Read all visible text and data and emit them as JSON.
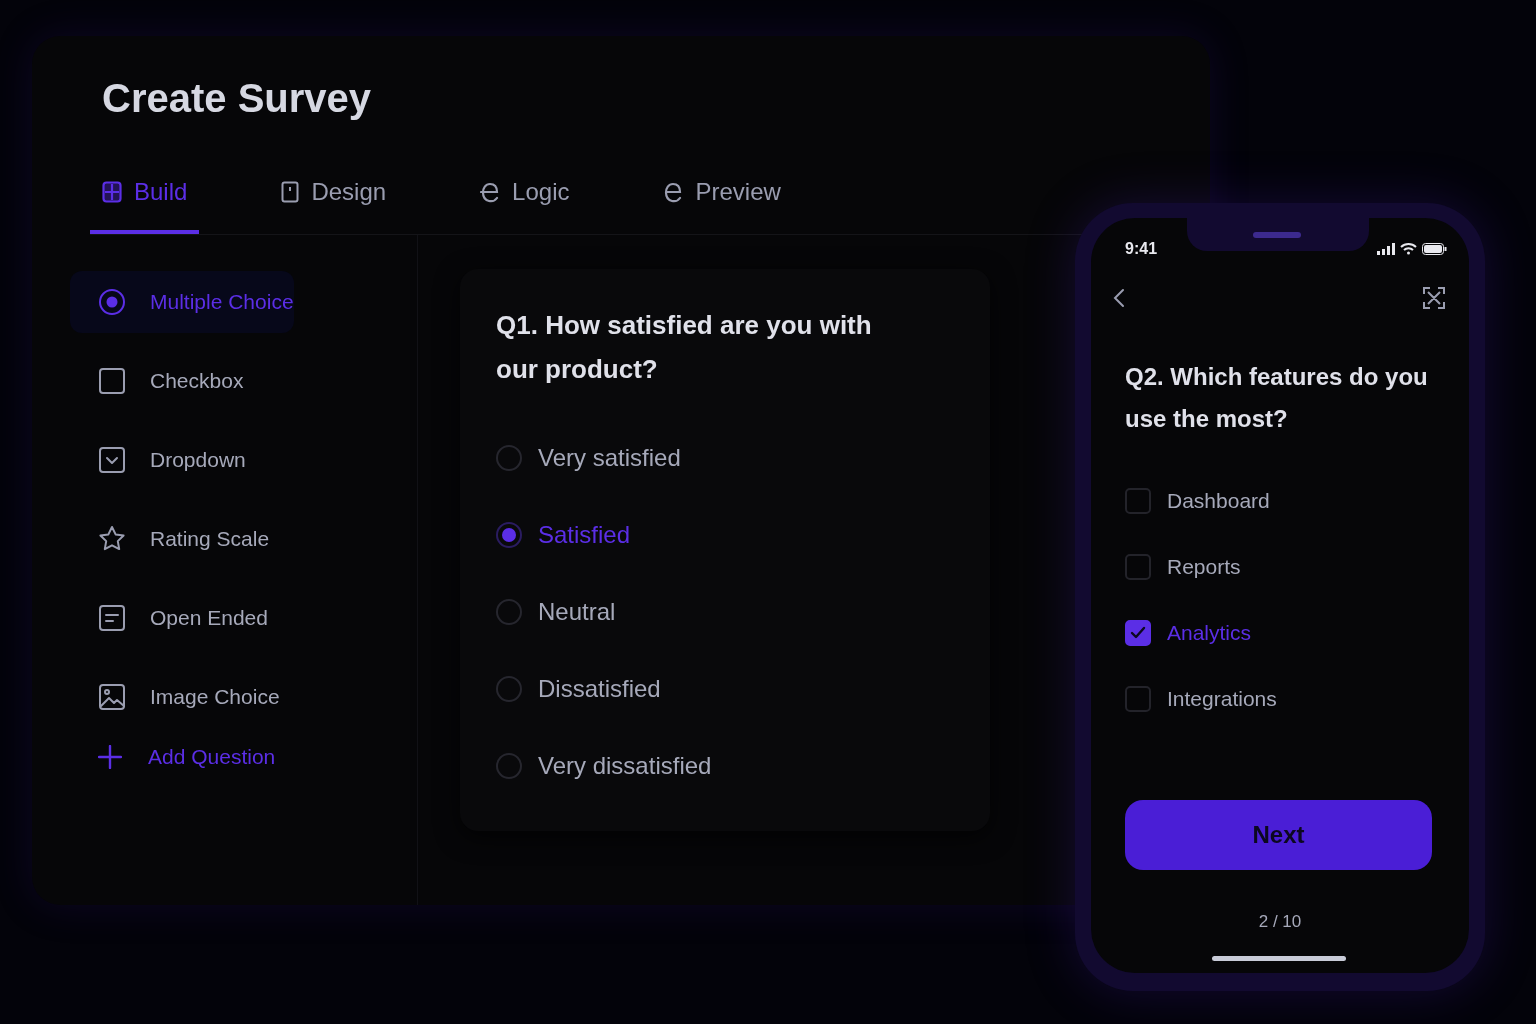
{
  "title": "Create Survey",
  "tabs": [
    {
      "label": "Build",
      "kind": "build",
      "selected": true
    },
    {
      "label": "Design",
      "kind": "design",
      "selected": false
    },
    {
      "label": "Logic",
      "kind": "logic",
      "selected": false
    },
    {
      "label": "Preview",
      "kind": "preview",
      "selected": false
    }
  ],
  "question_types": [
    {
      "label": "Multiple Choice",
      "kind": "radio",
      "selected": true
    },
    {
      "label": "Checkbox",
      "kind": "checkbox",
      "selected": false
    },
    {
      "label": "Dropdown",
      "kind": "dropdown",
      "selected": false
    },
    {
      "label": "Rating Scale",
      "kind": "rating",
      "selected": false
    },
    {
      "label": "Open Ended",
      "kind": "text",
      "selected": false
    },
    {
      "label": "Image Choice",
      "kind": "image",
      "selected": false
    }
  ],
  "add_question": "Add Question",
  "question": {
    "text": "Q1. How satisfied are you with our product?",
    "options": [
      {
        "label": "Very satisfied",
        "selected": false
      },
      {
        "label": "Satisfied",
        "selected": true
      },
      {
        "label": "Neutral",
        "selected": false
      },
      {
        "label": "Dissatisfied",
        "selected": false
      },
      {
        "label": "Very dissatisfied",
        "selected": false
      }
    ]
  },
  "phone": {
    "time": "9:41",
    "question": "Q2. Which features do you use the most?",
    "options": [
      {
        "label": "Dashboard",
        "checked": false
      },
      {
        "label": "Reports",
        "checked": false
      },
      {
        "label": "Analytics",
        "checked": true
      },
      {
        "label": "Integrations",
        "checked": false
      }
    ],
    "button": "Next",
    "progress": "2 / 10"
  }
}
